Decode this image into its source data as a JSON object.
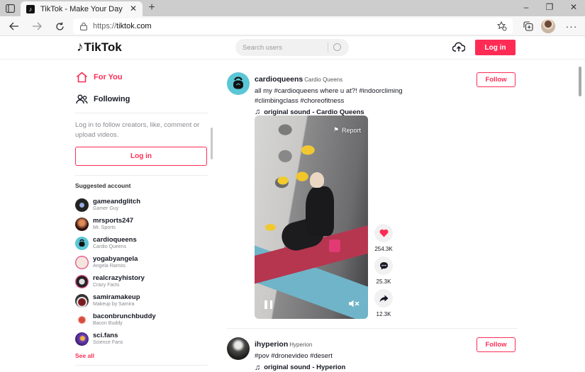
{
  "browser": {
    "tab_title": "TikTok - Make Your Day",
    "url_scheme": "https://",
    "url_host": "tiktok.com",
    "new_tab_label": "+",
    "close_tab_label": "✕",
    "minimize_label": "–",
    "restore_label": "❐",
    "close_window_label": "✕",
    "more_label": "···",
    "icons": [
      "tab-actions-icon",
      "back-icon",
      "forward-icon",
      "refresh-icon",
      "lock-icon",
      "favorite-star-icon",
      "collections-icon",
      "profile-avatar",
      "more-icon"
    ]
  },
  "header": {
    "logo_text": "TikTok",
    "search_placeholder": "Search users",
    "login_label": "Log in",
    "icons": [
      "upload-icon",
      "search-icon"
    ]
  },
  "sidebar": {
    "nav": [
      {
        "label": "For You",
        "icon": "home-icon",
        "active": true
      },
      {
        "label": "Following",
        "icon": "users-icon",
        "active": false
      }
    ],
    "login_prompt": "Log in to follow creators, like, comment or upload videos.",
    "login_label": "Log in",
    "suggested_title": "Suggested account",
    "accounts": [
      {
        "username": "gameandglitch",
        "nickname": "Gamer Guy"
      },
      {
        "username": "mrsports247",
        "nickname": "Mr. Sports"
      },
      {
        "username": "cardioqueens",
        "nickname": "Cardio Queens"
      },
      {
        "username": "yogabyangela",
        "nickname": "Angela Ramos"
      },
      {
        "username": "realcrazyhistory",
        "nickname": "Crazy Facts"
      },
      {
        "username": "samiramakeup",
        "nickname": "Makeup by Samira"
      },
      {
        "username": "baconbrunchbuddy",
        "nickname": "Bacon Buddy"
      },
      {
        "username": "sci.fans",
        "nickname": "Science Fans"
      }
    ],
    "see_all_label": "See all"
  },
  "feed": {
    "posts": [
      {
        "username": "cardioqueens",
        "nickname": "Cardio Queens",
        "caption": "all my #cardioqueens where u at?! #indoorcliming #climbingclass #choreofitness",
        "sound": "original sound - Cardio Queens",
        "follow_label": "Follow",
        "report_label": "Report",
        "likes": "254.3K",
        "comments": "25.3K",
        "shares": "12.3K"
      },
      {
        "username": "ihyperion",
        "nickname": "Hyperion",
        "caption": "#pov #dronevideo #desert",
        "sound": "original sound - Hyperion",
        "follow_label": "Follow"
      }
    ]
  },
  "colors": {
    "brand": "#fe2c55",
    "text": "#161823",
    "muted": "#8a8b91",
    "cardio_avatar": "#5bc6d6"
  }
}
